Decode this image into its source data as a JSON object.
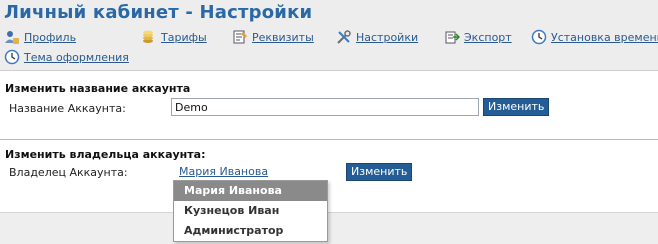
{
  "header": {
    "title": "Личный кабинет - Настройки",
    "nav": [
      {
        "label": "Профиль",
        "icon": "profile-icon"
      },
      {
        "label": "Тарифы",
        "icon": "coins-icon"
      },
      {
        "label": "Реквизиты",
        "icon": "requisites-icon"
      },
      {
        "label": "Настройки",
        "icon": "settings-tools-icon"
      },
      {
        "label": "Экспорт",
        "icon": "export-icon"
      },
      {
        "label": "Установка времени",
        "icon": "clock-icon"
      },
      {
        "label": "Тема оформления",
        "icon": "theme-clock-icon"
      }
    ]
  },
  "account_name_section": {
    "title": "Изменить название аккаунта",
    "label": "Название Аккаунта:",
    "value": "Demo",
    "button": "Изменить"
  },
  "owner_section": {
    "title": "Изменить владельца аккаунта:",
    "label": "Владелец Аккаунта:",
    "current_owner": "Мария Иванова",
    "button": "Изменить",
    "options": [
      "Мария Иванова",
      "Кузнецов Иван",
      "Администратор"
    ],
    "selected_index": 0
  },
  "colors": {
    "accent": "#245d96",
    "title": "#2a68a6",
    "link": "#2a5a8e",
    "selected_option": "#8a8a8a"
  }
}
